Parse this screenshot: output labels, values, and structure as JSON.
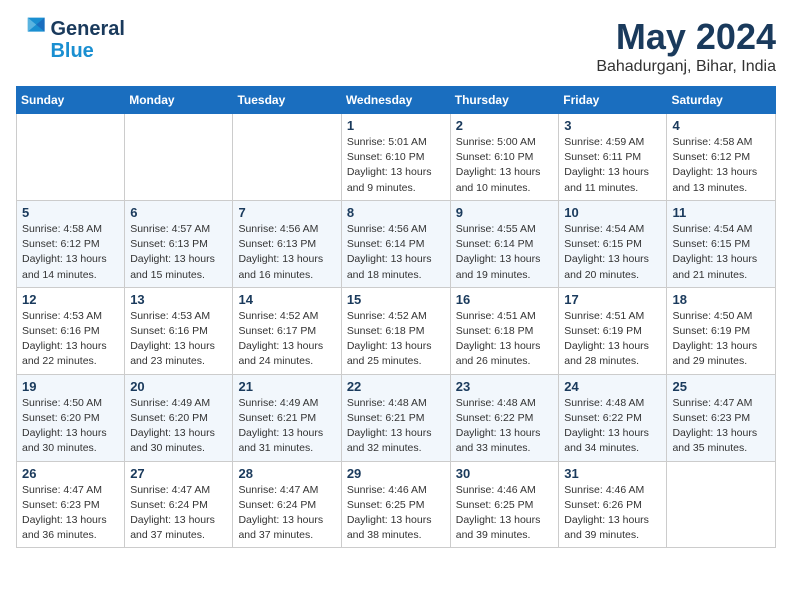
{
  "logo": {
    "line1": "General",
    "line2": "Blue"
  },
  "title": "May 2024",
  "location": "Bahadurganj, Bihar, India",
  "weekdays": [
    "Sunday",
    "Monday",
    "Tuesday",
    "Wednesday",
    "Thursday",
    "Friday",
    "Saturday"
  ],
  "weeks": [
    [
      null,
      null,
      null,
      {
        "day": "1",
        "sunrise": "5:01 AM",
        "sunset": "6:10 PM",
        "daylight": "13 hours and 9 minutes."
      },
      {
        "day": "2",
        "sunrise": "5:00 AM",
        "sunset": "6:10 PM",
        "daylight": "13 hours and 10 minutes."
      },
      {
        "day": "3",
        "sunrise": "4:59 AM",
        "sunset": "6:11 PM",
        "daylight": "13 hours and 11 minutes."
      },
      {
        "day": "4",
        "sunrise": "4:58 AM",
        "sunset": "6:12 PM",
        "daylight": "13 hours and 13 minutes."
      }
    ],
    [
      {
        "day": "5",
        "sunrise": "4:58 AM",
        "sunset": "6:12 PM",
        "daylight": "13 hours and 14 minutes."
      },
      {
        "day": "6",
        "sunrise": "4:57 AM",
        "sunset": "6:13 PM",
        "daylight": "13 hours and 15 minutes."
      },
      {
        "day": "7",
        "sunrise": "4:56 AM",
        "sunset": "6:13 PM",
        "daylight": "13 hours and 16 minutes."
      },
      {
        "day": "8",
        "sunrise": "4:56 AM",
        "sunset": "6:14 PM",
        "daylight": "13 hours and 18 minutes."
      },
      {
        "day": "9",
        "sunrise": "4:55 AM",
        "sunset": "6:14 PM",
        "daylight": "13 hours and 19 minutes."
      },
      {
        "day": "10",
        "sunrise": "4:54 AM",
        "sunset": "6:15 PM",
        "daylight": "13 hours and 20 minutes."
      },
      {
        "day": "11",
        "sunrise": "4:54 AM",
        "sunset": "6:15 PM",
        "daylight": "13 hours and 21 minutes."
      }
    ],
    [
      {
        "day": "12",
        "sunrise": "4:53 AM",
        "sunset": "6:16 PM",
        "daylight": "13 hours and 22 minutes."
      },
      {
        "day": "13",
        "sunrise": "4:53 AM",
        "sunset": "6:16 PM",
        "daylight": "13 hours and 23 minutes."
      },
      {
        "day": "14",
        "sunrise": "4:52 AM",
        "sunset": "6:17 PM",
        "daylight": "13 hours and 24 minutes."
      },
      {
        "day": "15",
        "sunrise": "4:52 AM",
        "sunset": "6:18 PM",
        "daylight": "13 hours and 25 minutes."
      },
      {
        "day": "16",
        "sunrise": "4:51 AM",
        "sunset": "6:18 PM",
        "daylight": "13 hours and 26 minutes."
      },
      {
        "day": "17",
        "sunrise": "4:51 AM",
        "sunset": "6:19 PM",
        "daylight": "13 hours and 28 minutes."
      },
      {
        "day": "18",
        "sunrise": "4:50 AM",
        "sunset": "6:19 PM",
        "daylight": "13 hours and 29 minutes."
      }
    ],
    [
      {
        "day": "19",
        "sunrise": "4:50 AM",
        "sunset": "6:20 PM",
        "daylight": "13 hours and 30 minutes."
      },
      {
        "day": "20",
        "sunrise": "4:49 AM",
        "sunset": "6:20 PM",
        "daylight": "13 hours and 30 minutes."
      },
      {
        "day": "21",
        "sunrise": "4:49 AM",
        "sunset": "6:21 PM",
        "daylight": "13 hours and 31 minutes."
      },
      {
        "day": "22",
        "sunrise": "4:48 AM",
        "sunset": "6:21 PM",
        "daylight": "13 hours and 32 minutes."
      },
      {
        "day": "23",
        "sunrise": "4:48 AM",
        "sunset": "6:22 PM",
        "daylight": "13 hours and 33 minutes."
      },
      {
        "day": "24",
        "sunrise": "4:48 AM",
        "sunset": "6:22 PM",
        "daylight": "13 hours and 34 minutes."
      },
      {
        "day": "25",
        "sunrise": "4:47 AM",
        "sunset": "6:23 PM",
        "daylight": "13 hours and 35 minutes."
      }
    ],
    [
      {
        "day": "26",
        "sunrise": "4:47 AM",
        "sunset": "6:23 PM",
        "daylight": "13 hours and 36 minutes."
      },
      {
        "day": "27",
        "sunrise": "4:47 AM",
        "sunset": "6:24 PM",
        "daylight": "13 hours and 37 minutes."
      },
      {
        "day": "28",
        "sunrise": "4:47 AM",
        "sunset": "6:24 PM",
        "daylight": "13 hours and 37 minutes."
      },
      {
        "day": "29",
        "sunrise": "4:46 AM",
        "sunset": "6:25 PM",
        "daylight": "13 hours and 38 minutes."
      },
      {
        "day": "30",
        "sunrise": "4:46 AM",
        "sunset": "6:25 PM",
        "daylight": "13 hours and 39 minutes."
      },
      {
        "day": "31",
        "sunrise": "4:46 AM",
        "sunset": "6:26 PM",
        "daylight": "13 hours and 39 minutes."
      },
      null
    ]
  ]
}
